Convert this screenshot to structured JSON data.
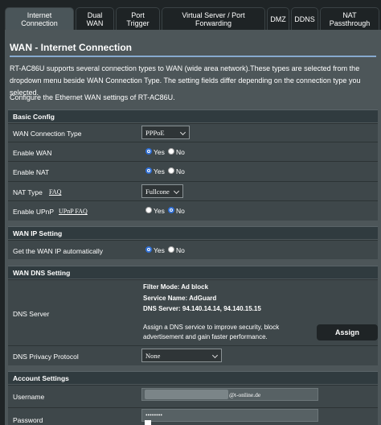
{
  "tabs": [
    {
      "line1": "Internet",
      "line2": "Connection"
    },
    {
      "line1": "Dual",
      "line2": "WAN"
    },
    {
      "line1": "Port",
      "line2": "Trigger"
    },
    {
      "line1": "Virtual Server / Port",
      "line2": "Forwarding"
    },
    {
      "line1": "DMZ",
      "line2": ""
    },
    {
      "line1": "DDNS",
      "line2": ""
    },
    {
      "line1": "NAT",
      "line2": "Passthrough"
    }
  ],
  "page": {
    "title": "WAN - Internet Connection",
    "description": "RT-AC86U supports several connection types to WAN (wide area network).These types are selected from the dropdown menu beside WAN Connection Type. The setting fields differ depending on the connection type you selected.",
    "description2": "Configure the Ethernet WAN settings of RT-AC86U."
  },
  "basic": {
    "header": "Basic Config",
    "wan_type_label": "WAN Connection Type",
    "wan_type_value": "PPPoE",
    "enable_wan_label": "Enable WAN",
    "enable_nat_label": "Enable NAT",
    "nat_type_label": "NAT Type",
    "nat_faq": "FAQ",
    "nat_type_value": "Fullcone",
    "upnp_label": "Enable UPnP",
    "upnp_faq": "UPnP FAQ",
    "yes": "Yes",
    "no": "No"
  },
  "wan_ip": {
    "header": "WAN IP Setting",
    "auto_label": "Get the WAN IP automatically"
  },
  "dns": {
    "header": "WAN DNS Setting",
    "label": "DNS Server",
    "filter_mode": "Filter Mode: Ad block",
    "service_name": "Service Name: AdGuard",
    "dns_server": "DNS Server: 94.140.14.14, 94.140.15.15",
    "hint": "Assign a DNS service to improve security, block advertisement and gain faster performance.",
    "assign_label": "Assign",
    "privacy_label": "DNS Privacy Protocol",
    "privacy_value": "None"
  },
  "account": {
    "header": "Account Settings",
    "username_label": "Username",
    "username_suffix": "@t-online.de",
    "password_label": "Password",
    "password_value": "••••••••"
  },
  "colors": {
    "accent_line": "#87aacf",
    "radio_on": "#2f6fd6"
  }
}
